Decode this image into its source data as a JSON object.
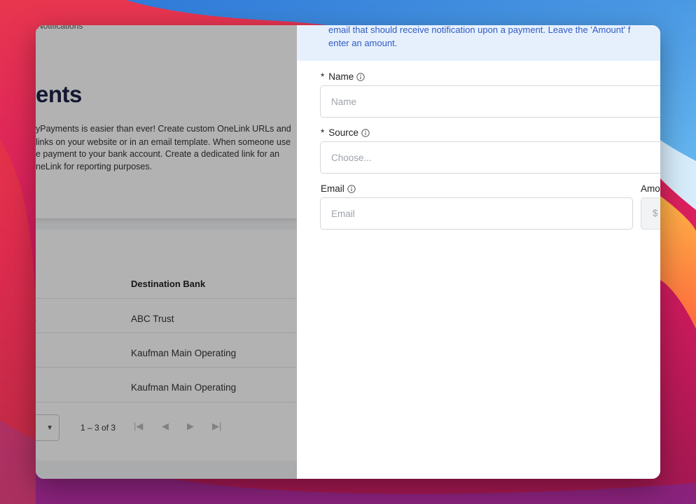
{
  "background_app": {
    "breadcrumb": "Notifications",
    "page_title": "ents",
    "description_lines": [
      "yPayments is easier than ever! Create custom OneLink URLs and",
      "links on your website or in an email template. When someone use",
      "e payment to your bank account. Create a dedicated link for an",
      "neLink for reporting purposes."
    ],
    "table": {
      "column_header": "Destination Bank",
      "rows": [
        {
          "left": "s",
          "bank": "ABC Trust"
        },
        {
          "left": "",
          "bank": "Kaufman Main Operating"
        },
        {
          "left": "",
          "bank": "Kaufman Main Operating"
        }
      ],
      "range_text": "1 – 3 of 3"
    }
  },
  "drawer": {
    "banner_lines": [
      "email that should receive notification upon a payment. Leave the 'Amount' f",
      "enter an amount."
    ],
    "fields": {
      "name": {
        "required_mark": "*",
        "label": "Name",
        "placeholder": "Name"
      },
      "source": {
        "required_mark": "*",
        "label": "Source",
        "placeholder": "Choose..."
      },
      "email": {
        "label": "Email",
        "placeholder": "Email"
      },
      "amount": {
        "label": "Amo",
        "prefix": "$"
      }
    }
  },
  "colors": {
    "banner_bg": "#e6f0fd",
    "banner_text": "#2f5bc4",
    "title_navy": "#1f2348"
  },
  "icons": {
    "field_info": "info-circle-icon",
    "pager": [
      "first-page-icon",
      "prev-page-icon",
      "next-page-icon",
      "last-page-icon"
    ]
  }
}
